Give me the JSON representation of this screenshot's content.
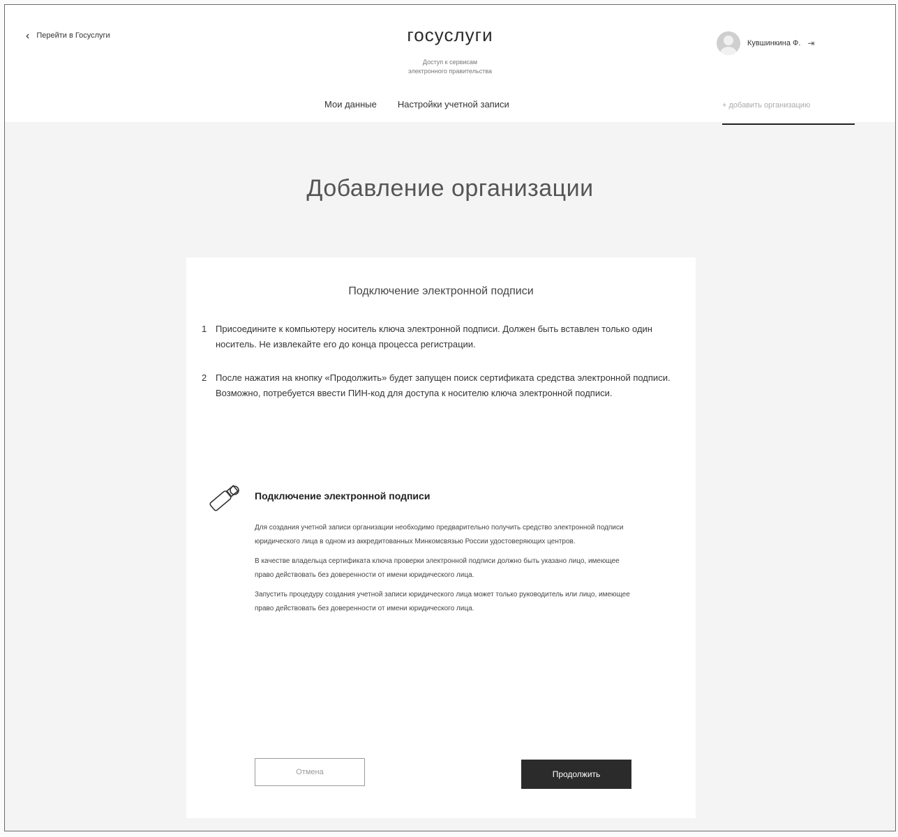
{
  "header": {
    "back_link": "Перейти в Госуслуги",
    "logo": "госуслуги",
    "subtitle_line1": "Доступ к сервисам",
    "subtitle_line2": "электронного правительства",
    "nav": [
      "Мои данные",
      "Настройки учетной записи"
    ],
    "user_name": "Кувшинкина Ф.",
    "add_org": "+ добавить организацию"
  },
  "page_title": "Добавление организации",
  "card": {
    "title": "Подключение электронной подписи",
    "steps": [
      {
        "num": "1",
        "text": "Присоедините к компьютеру носитель ключа электронной подписи. Должен быть вставлен только один носитель. Не извлекайте его до конца процесса регистрации."
      },
      {
        "num": "2",
        "text": "После нажатия на кнопку «Продолжить» будет запущен поиск сертификата средства электронной подписи. Возможно, потребуется ввести ПИН-код для доступа к носителю ключа электронной подписи."
      }
    ],
    "info_title": "Подключение электронной подписи",
    "info_paragraphs": [
      "Для создания учетной записи организации необходимо предварительно получить средство электронной подписи юридического лица в одном из аккредитованных Минкомсвязью России удостоверяющих центров.",
      "В качестве владельца сертификата ключа проверки электронной подписи должно быть указано лицо, имеющее право действовать без доверенности от имени юридического лица.",
      "Запустить процедуру создания учетной записи юридического лица может только руководитель или лицо, имеющее право действовать без доверенности от имени юридического лица."
    ],
    "cancel_label": "Отмена",
    "continue_label": "Продолжить"
  },
  "icons": {
    "back": "chevron-left-icon",
    "logout": "logout-icon",
    "usb": "usb-key-icon"
  }
}
